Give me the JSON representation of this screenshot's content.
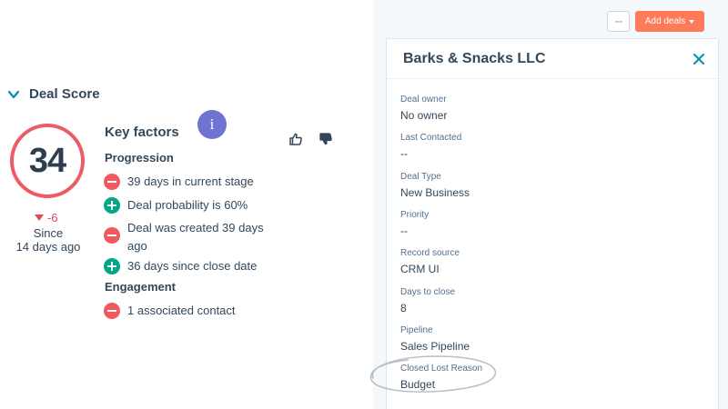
{
  "deal_score": {
    "section_title": "Deal Score",
    "score": "34",
    "delta": "-6",
    "since_line1": "Since",
    "since_line2": "14 days ago",
    "info_glyph": "i",
    "key_factors_title": "Key factors",
    "groups": [
      {
        "heading": "Progression",
        "factors": [
          {
            "text": "39 days in current stage",
            "impact": "negative"
          },
          {
            "text": "Deal probability is 60%",
            "impact": "positive"
          },
          {
            "line1": "Deal was created 39 days",
            "line2": "ago",
            "impact": "negative"
          },
          {
            "text": "36 days since close date",
            "impact": "positive"
          }
        ]
      },
      {
        "heading": "Engagement",
        "factors": [
          {
            "text": "1 associated contact",
            "impact": "negative"
          }
        ]
      }
    ],
    "icons": {
      "collapse": "chevron-down-icon",
      "thumbs_up": "thumbs-up-icon",
      "thumbs_down": "thumbs-down-icon",
      "info": "info-icon"
    },
    "colors": {
      "ring": "#ee5b64",
      "negative": "#f05a5f",
      "positive": "#00a888",
      "info": "#6f73d2"
    }
  },
  "toolbar": {
    "more_glyph": "···",
    "add_deals_label": "Add deals",
    "accent": "#ff7a59"
  },
  "record": {
    "title": "Barks & Snacks LLC",
    "properties": [
      {
        "label": "Deal owner",
        "value": "No owner"
      },
      {
        "label": "Last Contacted",
        "value": "--"
      },
      {
        "label": "Deal Type",
        "value": "New Business"
      },
      {
        "label": "Priority",
        "value": "--"
      },
      {
        "label": "Record source",
        "value": "CRM UI"
      },
      {
        "label": "Days to close",
        "value": "8"
      },
      {
        "label": "Pipeline",
        "value": "Sales Pipeline"
      },
      {
        "label": "Closed Lost Reason",
        "value": "Budget"
      }
    ]
  }
}
